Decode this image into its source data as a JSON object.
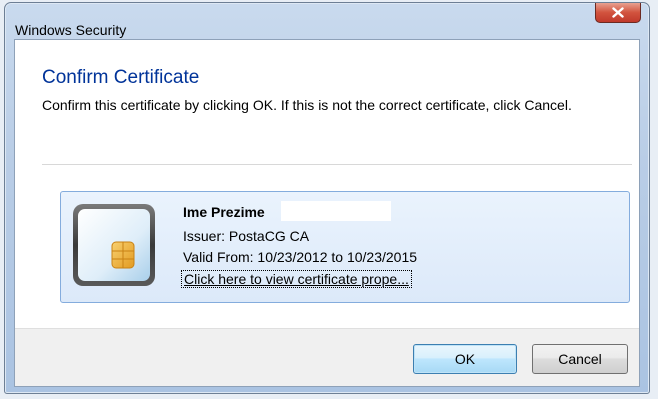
{
  "window": {
    "title": "Windows Security",
    "close_symbol": "X"
  },
  "dialog": {
    "heading": "Confirm Certificate",
    "instruction": "Confirm this certificate by clicking OK. If this is not the correct certificate, click Cancel."
  },
  "certificate": {
    "icon": "certificate-card-icon",
    "name": "Ime Prezime",
    "issuer": "Issuer: PostaCG CA",
    "valid": "Valid From: 10/23/2012 to 10/23/2015",
    "link": "Click here to view certificate prope..."
  },
  "buttons": {
    "ok": "OK",
    "cancel": "Cancel"
  },
  "colors": {
    "heading": "#003399",
    "tile_border": "#84acdd",
    "close_button": "#c0392b"
  }
}
